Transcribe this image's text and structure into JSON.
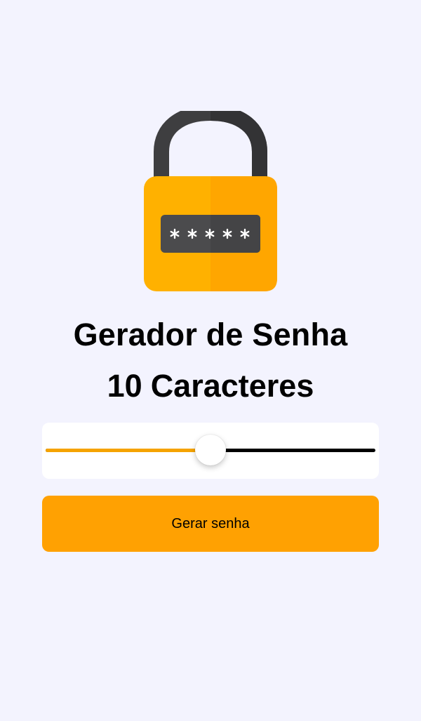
{
  "app": {
    "title": "Gerador de Senha"
  },
  "length": {
    "count": "10",
    "unit": "Caracteres"
  },
  "slider": {
    "value": 10,
    "min": 6,
    "max": 14,
    "fill_fraction": 0.5
  },
  "actions": {
    "generate_label": "Gerar senha"
  },
  "colors": {
    "background": "#f3f3fe",
    "accent": "#ffa102",
    "slider_fill": "#f5a300",
    "slider_track": "#000000",
    "card": "#ffffff"
  },
  "icons": {
    "hero": "padlock-icon",
    "password_mask": "asterisk-icon"
  }
}
